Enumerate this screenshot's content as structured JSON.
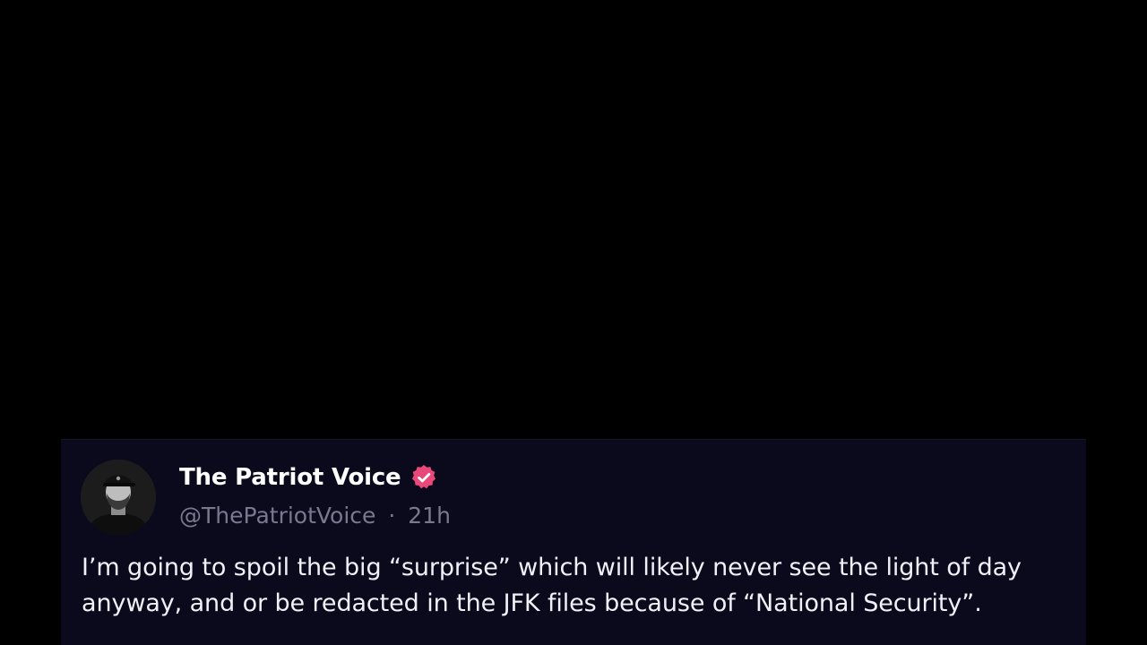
{
  "post": {
    "display_name": "The Patriot Voice",
    "handle": "@ThePatriotVoice",
    "separator": "·",
    "time": "21h",
    "text": "I’m going to spoil the big “surprise” which will likely never see the light of day anyway, and or be redacted in the JFK files because of “National Security”.",
    "verified": true
  },
  "icons": {
    "verified": "verified-badge-icon",
    "avatar": "user-photo"
  },
  "colors": {
    "background": "#000000",
    "card": "#0b0a1c",
    "name": "#ffffff",
    "meta": "#7a788f",
    "body_text": "#f1f0f7",
    "badge": "#e8497a"
  }
}
